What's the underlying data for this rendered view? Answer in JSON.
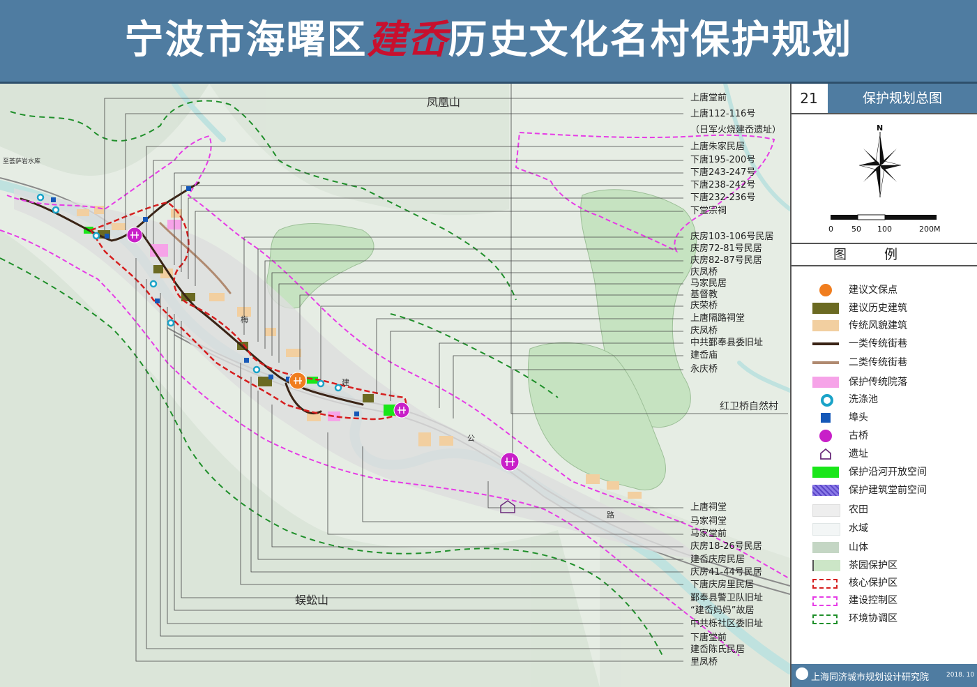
{
  "title": {
    "prefix": "宁波市海曙区",
    "highlight": "建岙",
    "suffix": "历史文化名村保护规划"
  },
  "sheet": {
    "number": "21",
    "name": "保护规划总图"
  },
  "north_label": "N",
  "scale": {
    "ticks": [
      "0",
      "50",
      "100",
      "200M"
    ]
  },
  "legend_title": "图例",
  "legend": [
    {
      "label": "建议文保点",
      "icon": "cultural-relic-icon",
      "color": "#f07d1e"
    },
    {
      "label": "建议历史建筑",
      "icon": "historic-building-swatch",
      "color": "#6b6a22"
    },
    {
      "label": "传统风貌建筑",
      "icon": "traditional-building-swatch",
      "color": "#f2cfa0"
    },
    {
      "label": "一类传统街巷",
      "icon": "class1-lane-swatch",
      "color": "#3a2416"
    },
    {
      "label": "二类传统街巷",
      "icon": "class2-lane-swatch",
      "color": "#b08a70"
    },
    {
      "label": "保护传统院落",
      "icon": "courtyard-swatch",
      "color": "#f6a3e8"
    },
    {
      "label": "洗涤池",
      "icon": "washing-pool-icon",
      "color": "#1aa3c8"
    },
    {
      "label": "埠头",
      "icon": "pier-icon",
      "color": "#1558b8"
    },
    {
      "label": "古桥",
      "icon": "ancient-bridge-icon",
      "color": "#c81fc8"
    },
    {
      "label": "遗址",
      "icon": "ruins-icon",
      "color": "#6a2a7a"
    },
    {
      "label": "保护沿河开放空间",
      "icon": "riverside-space-swatch",
      "color": "#19e619"
    },
    {
      "label": "保护建筑堂前空间",
      "icon": "front-space-swatch",
      "color": "#8a7ae6"
    },
    {
      "label": "农田",
      "icon": "farmland-swatch",
      "color": "#eeeeee"
    },
    {
      "label": "水域",
      "icon": "water-swatch",
      "color": "#f3f6f6"
    },
    {
      "label": "山体",
      "icon": "mountain-swatch",
      "color": "#c4d6c4"
    },
    {
      "label": "茶园保护区",
      "icon": "tea-garden-swatch",
      "color": "#cce6c7"
    },
    {
      "label": "核心保护区",
      "icon": "core-zone-swatch",
      "color": "#d61e1e"
    },
    {
      "label": "建设控制区",
      "icon": "control-zone-swatch",
      "color": "#e63ce6"
    },
    {
      "label": "环境协调区",
      "icon": "coordination-zone-swatch",
      "color": "#1f8f2a"
    }
  ],
  "map_labels": {
    "phoenix_mountain": "凤凰山",
    "centipede_mountain": "蜈蚣山",
    "reservoir_road": "至荟萨岩水库",
    "hongweiqiao": "红卫桥自然村",
    "road_1": "建",
    "road_2": "公",
    "road_3": "路",
    "mei": "梅"
  },
  "callouts_top": [
    "上唐堂前",
    "上唐112-116号",
    "（日军火烧建岙遗址）",
    "上唐朱家民居",
    "下唐195-200号",
    "下唐243-247号",
    "下唐238-242号",
    "下唐232-236号",
    "下堂宗祠",
    "庆房103-106号民居",
    "庆房72-81号民居",
    "庆房82-87号民居",
    "庆凤桥",
    "马家民居",
    "基督教",
    "庆荣桥",
    "上唐隔路祠堂",
    "庆凤桥",
    "中共鄞奉县委旧址",
    "建岙庙",
    "永庆桥"
  ],
  "callouts_bottom": [
    "上唐祠堂",
    "马家祠堂",
    "马家堂前",
    "庆房18-26号民居",
    "建岙庆房民居",
    "庆房41-44号民居",
    "下唐庆房里民居",
    "鄞奉县警卫队旧址",
    "“建岙妈妈”故居",
    "中共栎社区委旧址",
    "下唐堂前",
    "建岙陈氏民居",
    "里凤桥"
  ],
  "footer": {
    "org": "上海同济城市规划设计研究院",
    "date": "2018. 10"
  }
}
